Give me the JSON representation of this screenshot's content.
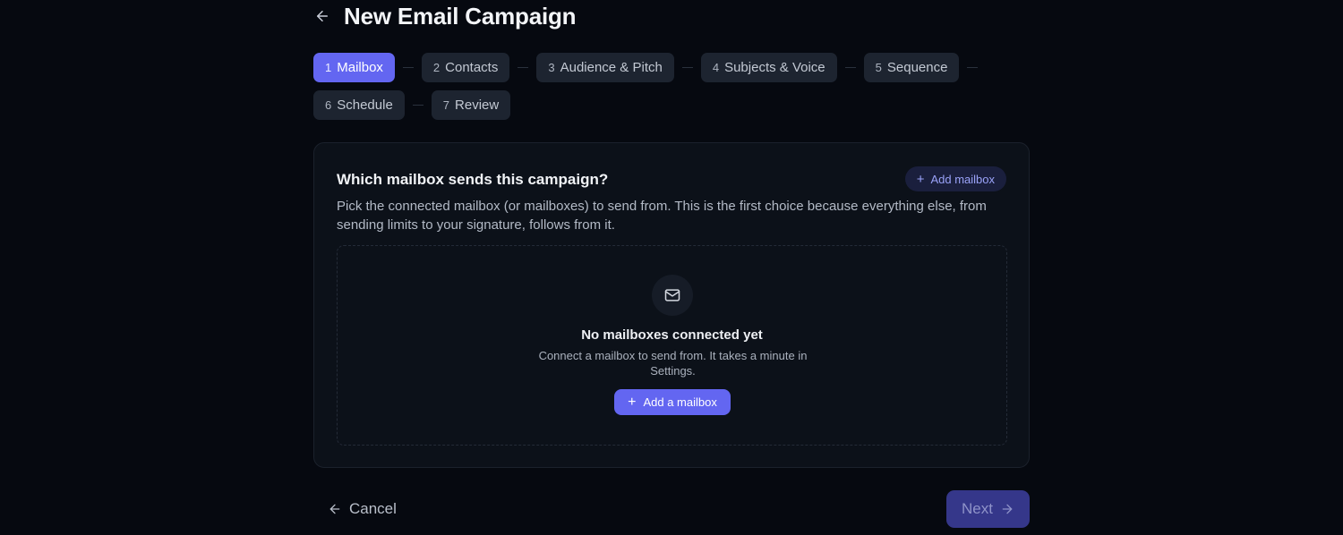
{
  "header": {
    "back_icon": "arrow-left-icon",
    "title": "New Email Campaign"
  },
  "stepper": {
    "steps": [
      {
        "num": "1",
        "label": "Mailbox",
        "active": true
      },
      {
        "num": "2",
        "label": "Contacts",
        "active": false
      },
      {
        "num": "3",
        "label": "Audience & Pitch",
        "active": false
      },
      {
        "num": "4",
        "label": "Subjects & Voice",
        "active": false
      },
      {
        "num": "5",
        "label": "Sequence",
        "active": false
      },
      {
        "num": "6",
        "label": "Schedule",
        "active": false
      },
      {
        "num": "7",
        "label": "Review",
        "active": false
      }
    ]
  },
  "card": {
    "title": "Which mailbox sends this campaign?",
    "add_button": "Add mailbox",
    "description": "Pick the connected mailbox (or mailboxes) to send from. This is the first choice because everything else, from sending limits to your signature, follows from it.",
    "empty_state": {
      "icon": "mail-icon",
      "title": "No mailboxes connected yet",
      "subtitle": "Connect a mailbox to send from. It takes a minute in Settings.",
      "button": "Add a mailbox"
    }
  },
  "footer": {
    "cancel": "Cancel",
    "next": "Next"
  },
  "colors": {
    "accent": "#6366f1",
    "background": "#060910",
    "card": "#0c1119",
    "step_inactive": "#1d2430"
  }
}
